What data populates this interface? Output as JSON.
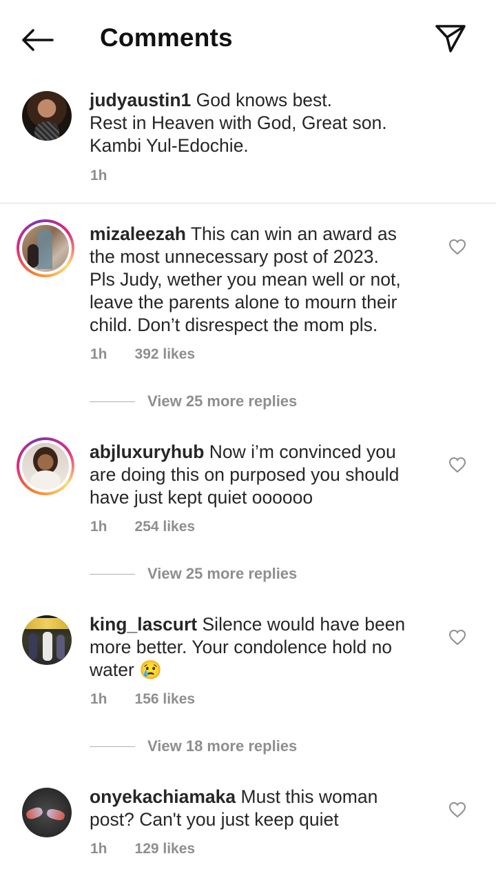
{
  "header": {
    "title": "Comments",
    "back_icon": "arrow-left-icon",
    "share_icon": "paper-plane-icon"
  },
  "caption": {
    "username": "judyaustin1",
    "text": "God knows best.",
    "lines": [
      "Rest in Heaven with God, Great son.",
      "Kambi Yul-Edochie."
    ],
    "time": "1h"
  },
  "comments": [
    {
      "username": "mizaleezah",
      "text": "This can win an award as",
      "lines": [
        "the most unnecessary post of 2023.",
        "Pls Judy, wether you mean well or not,",
        "leave the parents alone to mourn their",
        "child. Don’t disrespect the mom pls."
      ],
      "time": "1h",
      "likes": "392 likes",
      "replies": "View 25 more replies",
      "has_story_ring": true
    },
    {
      "username": "abjluxuryhub",
      "text": "Now i’m convinced you",
      "lines": [
        "are doing this on purposed you should",
        "have just kept quiet oooooo"
      ],
      "time": "1h",
      "likes": "254 likes",
      "replies": "View 25 more replies",
      "has_story_ring": true
    },
    {
      "username": "king_lascurt",
      "text": "Silence would have been",
      "lines": [
        "more better. Your condolence hold no",
        "water 😢"
      ],
      "time": "1h",
      "likes": "156 likes",
      "replies": "View 18 more replies",
      "has_story_ring": false
    },
    {
      "username": "onyekachiamaka",
      "text": "Must this woman",
      "lines": [
        "post? Can't you just keep quiet"
      ],
      "time": "1h",
      "likes": "129 likes",
      "has_story_ring": false
    }
  ],
  "colors": {
    "text": "#262626",
    "secondary": "#8e8e8e",
    "divider": "#dbdbdb"
  }
}
